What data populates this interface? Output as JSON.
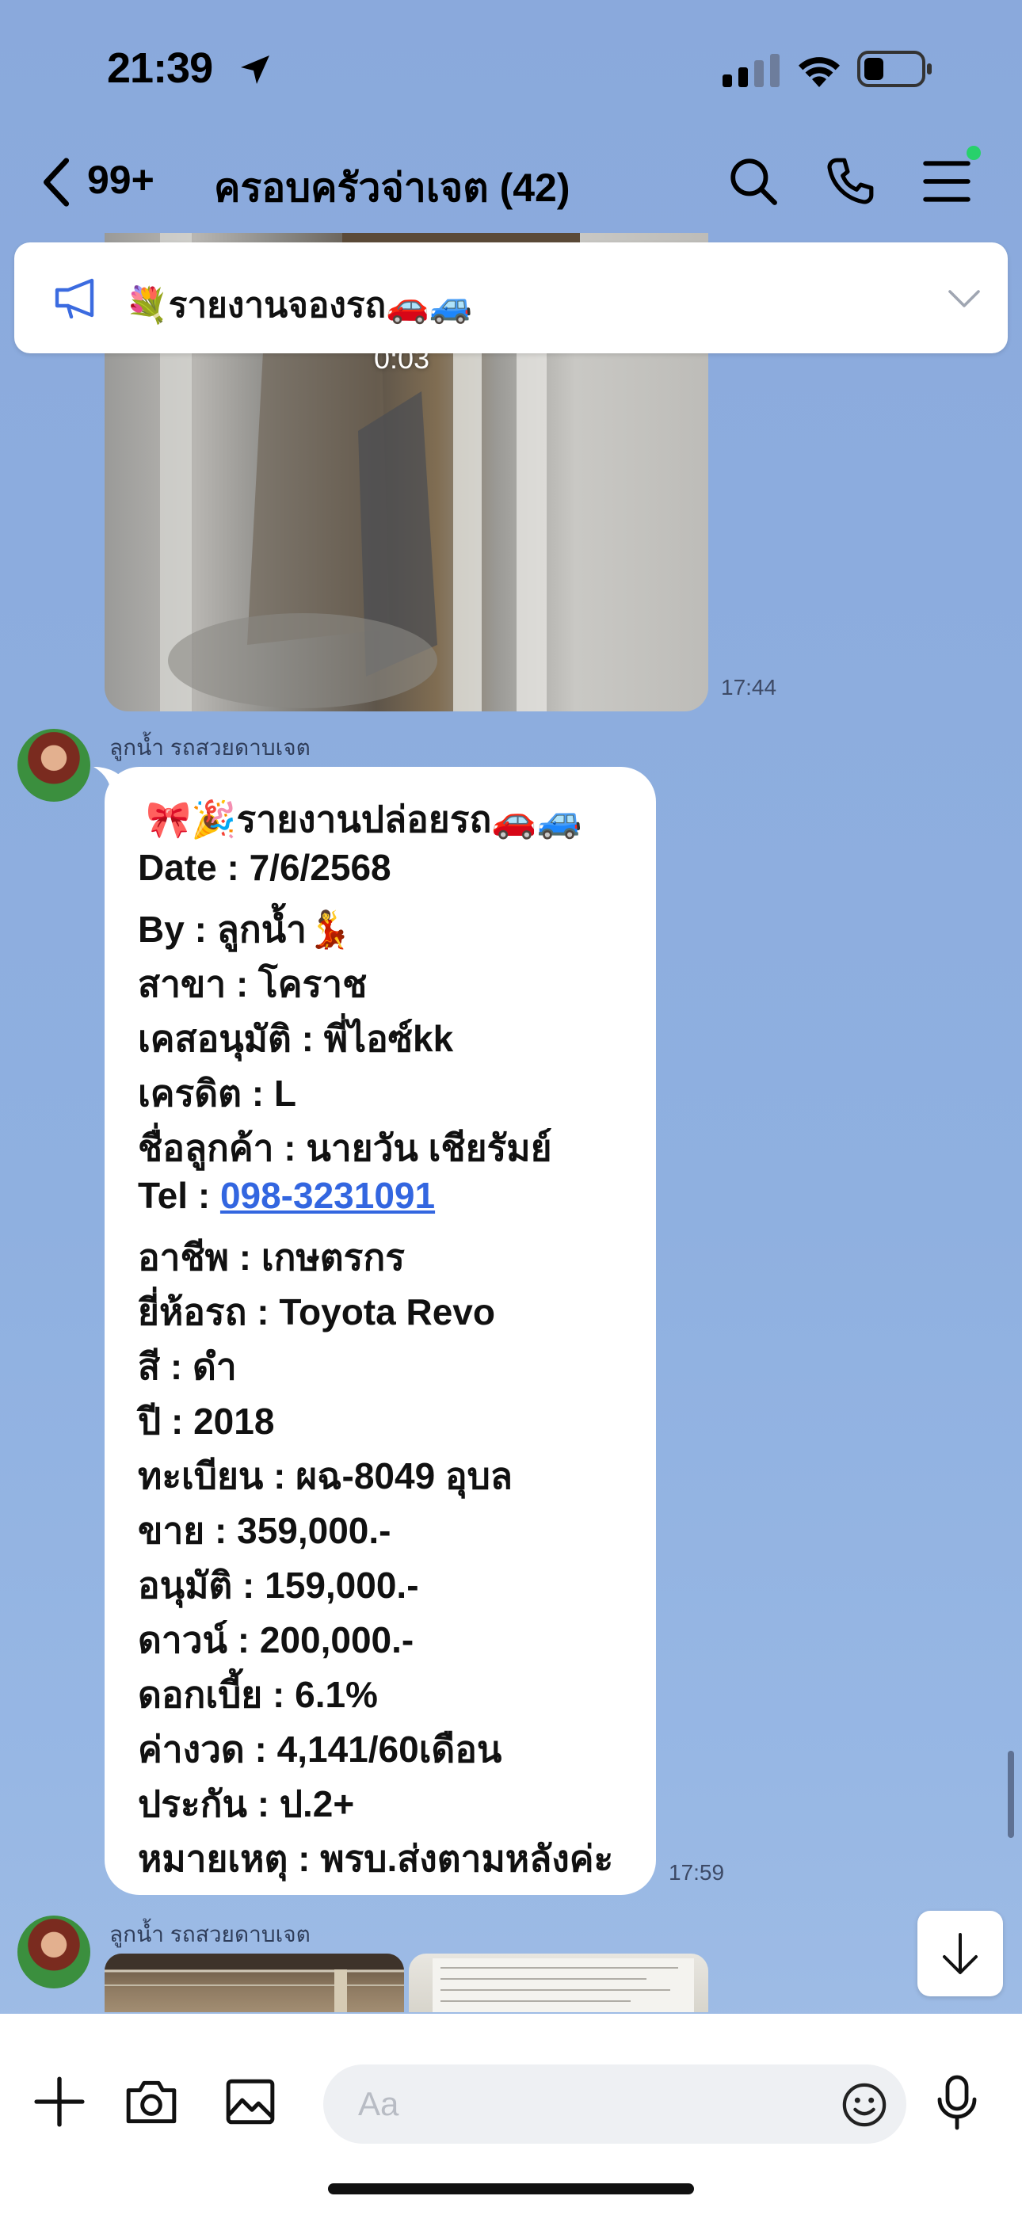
{
  "status_bar": {
    "time": "21:39"
  },
  "header": {
    "back_count": "99+",
    "title": "ครอบครัวจ่าเจต (42)"
  },
  "announcement": {
    "text": "💐รายงานจองรถ🚗🚙"
  },
  "video_message": {
    "duration": "0:03",
    "time": "17:44"
  },
  "messages": [
    {
      "sender": "ลูกน้ำ รถสวยดาบเจต",
      "time": "17:59",
      "lines": {
        "heading": "🎀🎉รายงานปล่อยรถ🚗🚙",
        "date": "Date : 7/6/2568",
        "by": "By : ลูกน้ำ💃",
        "branch": "สาขา : โคราช",
        "approver": "เคสอนุมัติ : พี่ไอซ์kk",
        "credit": "เครดิต : L",
        "customer": "ชื่อลูกค้า : นายวัน เชียรัมย์",
        "tel_label": "Tel : ",
        "tel_number": "098-3231091",
        "occupation": "อาชีพ : เกษตรกร",
        "brand": "ยี่ห้อรถ : Toyota Revo",
        "color": "สี : ดำ",
        "year": "ปี : 2018",
        "plate": "ทะเบียน : ผฉ-8049 อุบล",
        "price": "ขาย : 359,000.-",
        "approved": "อนุมัติ : 159,000.-",
        "down": "ดาวน์ : 200,000.-",
        "interest": "ดอกเบี้ย : 6.1%",
        "installment": "ค่างวด : 4,141/60เดือน",
        "insurance": "ประกัน : ป.2+",
        "note": "หมายเหตุ : พรบ.ส่งตามหลังค่ะ"
      }
    },
    {
      "sender": "ลูกน้ำ รถสวยดาบเจต"
    }
  ],
  "input": {
    "placeholder": "Aa"
  },
  "colors": {
    "background": "#8aa9dc",
    "link": "#3366e0",
    "online_dot": "#28d16b"
  }
}
